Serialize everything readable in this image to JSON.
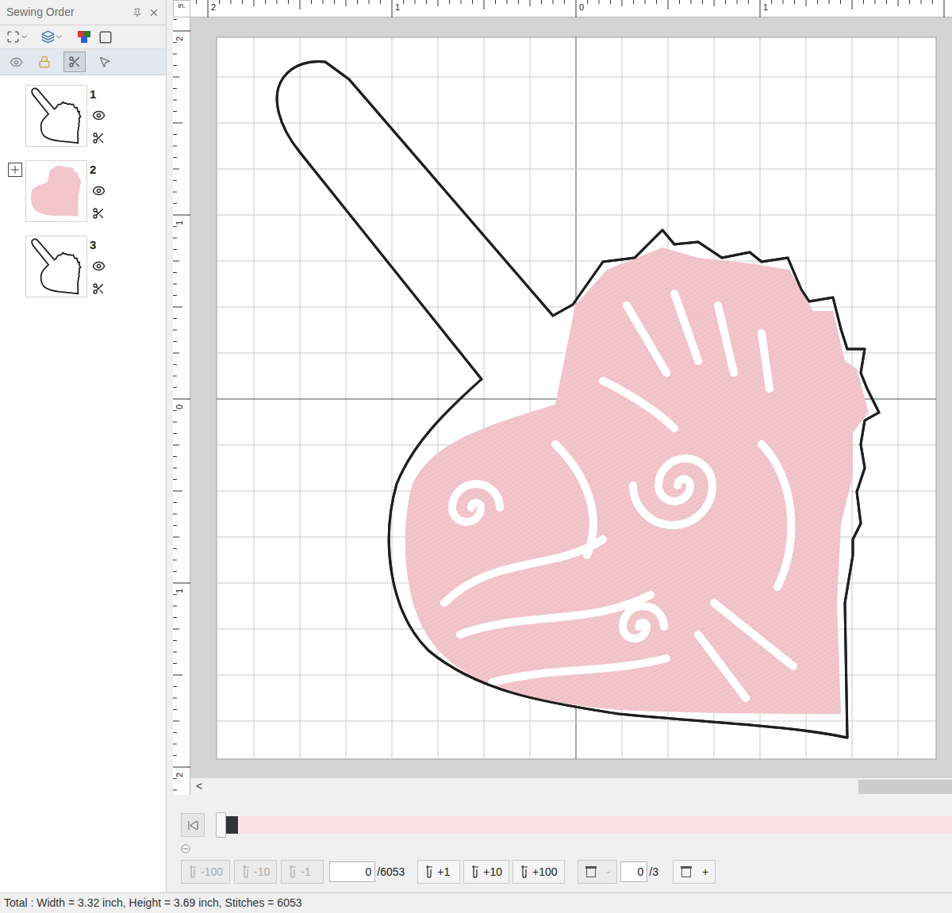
{
  "panel": {
    "title": "Sewing Order"
  },
  "view_tools": [
    {
      "selected": false
    },
    {
      "selected": false
    },
    {
      "selected": true
    },
    {
      "selected": false
    }
  ],
  "items": [
    {
      "number": "1",
      "kind": "outline",
      "visible": true,
      "expandable": false,
      "expanded": false,
      "color": "#1f1f1f"
    },
    {
      "number": "2",
      "kind": "fill",
      "visible": true,
      "expandable": true,
      "expanded": false,
      "color": "#f2c6cb"
    },
    {
      "number": "3",
      "kind": "outline",
      "visible": true,
      "expandable": false,
      "expanded": false,
      "color": "#1f1f1f"
    }
  ],
  "ruler": {
    "unit": "in.",
    "top_labels": [
      "2",
      "1",
      "0",
      "1"
    ],
    "left_labels": [
      "2",
      "1",
      "0",
      "1",
      "2"
    ]
  },
  "scrollbar": {
    "left_arrow": "<"
  },
  "stitch_bar": {
    "level": 0,
    "segments": [
      {
        "color": "#2f3436",
        "share": 0.03
      },
      {
        "color": "#fde1e4",
        "share": 0.97
      }
    ]
  },
  "stitch_controls": {
    "back": [
      {
        "label": "-100",
        "disabled": true
      },
      {
        "label": "-10",
        "disabled": true
      },
      {
        "label": "-1",
        "disabled": true
      }
    ],
    "value": "0",
    "total": "/6053",
    "forward": [
      {
        "label": "+1",
        "disabled": false
      },
      {
        "label": "+10",
        "disabled": false
      },
      {
        "label": "+100",
        "disabled": false
      }
    ]
  },
  "frame_controls": {
    "minus": {
      "label": "-",
      "disabled": true
    },
    "value": "0",
    "total": "/3",
    "plus": {
      "label": "+",
      "disabled": false
    }
  },
  "status_bar": "Total : Width = 3.32 inch, Height = 3.69 inch, Stitches = 6053"
}
